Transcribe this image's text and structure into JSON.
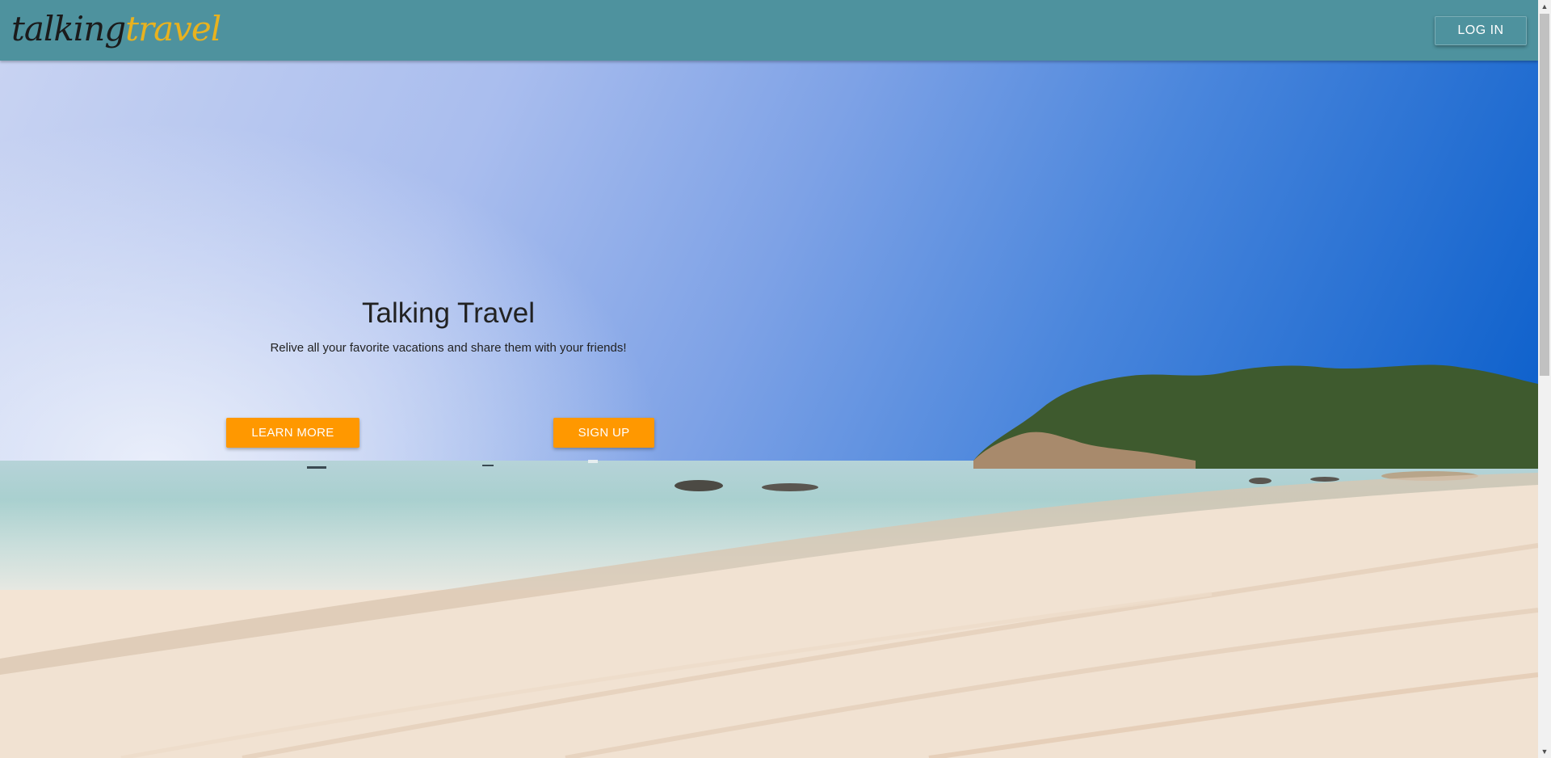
{
  "header": {
    "logo_part1": "talking",
    "logo_part2": "travel",
    "login_label": "LOG IN"
  },
  "hero": {
    "title": "Talking Travel",
    "subtitle": "Relive all your favorite vacations and share them with your friends!",
    "learn_more_label": "LEARN MORE",
    "sign_up_label": "SIGN UP",
    "background": "beach-photo"
  },
  "colors": {
    "header_bg": "#4e929e",
    "logo_dark": "#1b1b1b",
    "logo_accent": "#e8b21f",
    "cta_orange": "#ff9800"
  },
  "scrollbar": {
    "up_icon": "scroll-up-arrow",
    "down_icon": "scroll-down-arrow"
  }
}
